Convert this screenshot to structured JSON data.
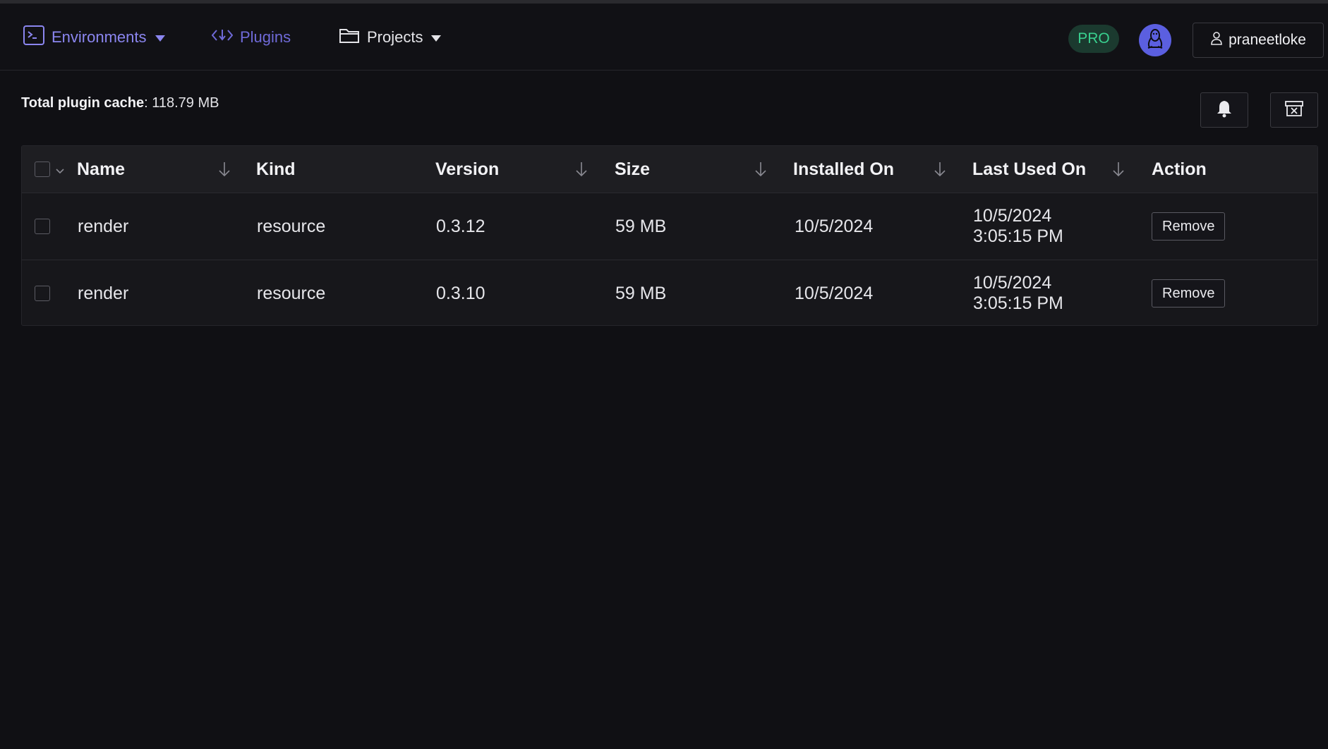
{
  "nav": {
    "environments_label": "Environments",
    "plugins_label": "Plugins",
    "projects_label": "Projects",
    "pro_badge": "PRO",
    "username": "praneetloke"
  },
  "cache": {
    "label": "Total plugin cache",
    "separator": ":",
    "value": "118.79 MB"
  },
  "table": {
    "columns": [
      "Name",
      "Kind",
      "Version",
      "Size",
      "Installed On",
      "Last Used On",
      "Action"
    ],
    "rows": [
      {
        "name": "render",
        "kind": "resource",
        "version": "0.3.12",
        "size": "59 MB",
        "installed_on": "10/5/2024",
        "last_used_date": "10/5/2024",
        "last_used_time": "3:05:15 PM",
        "action": "Remove"
      },
      {
        "name": "render",
        "kind": "resource",
        "version": "0.3.10",
        "size": "59 MB",
        "installed_on": "10/5/2024",
        "last_used_date": "10/5/2024",
        "last_used_time": "3:05:15 PM",
        "action": "Remove"
      }
    ]
  },
  "colors": {
    "accent": "#8b86f0",
    "pro_text": "#39d08f",
    "avatar_bg": "#5b5fe0"
  }
}
